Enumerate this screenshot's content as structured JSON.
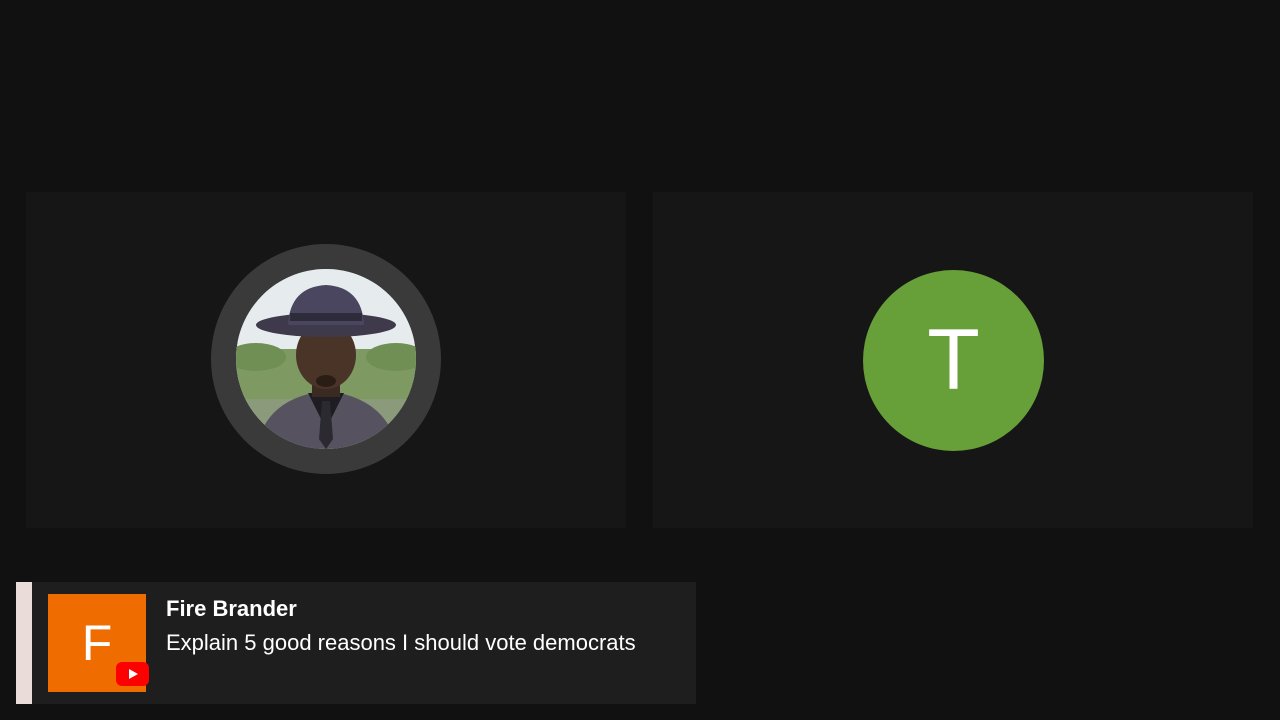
{
  "participants": [
    {
      "type": "photo",
      "icon": "person-photo-avatar"
    },
    {
      "type": "initial",
      "initial": "T",
      "color": "#679f38"
    }
  ],
  "chat": {
    "author": "Fire Brander",
    "author_initial": "F",
    "avatar_color": "#ef6c00",
    "platform_icon": "youtube-icon",
    "message": "Explain 5 good reasons I should vote democrats"
  },
  "colors": {
    "background": "#111111",
    "tile": "#161616",
    "banner": "#1e1e1e",
    "accent": "#eadcd8",
    "youtube_red": "#ff0000"
  }
}
